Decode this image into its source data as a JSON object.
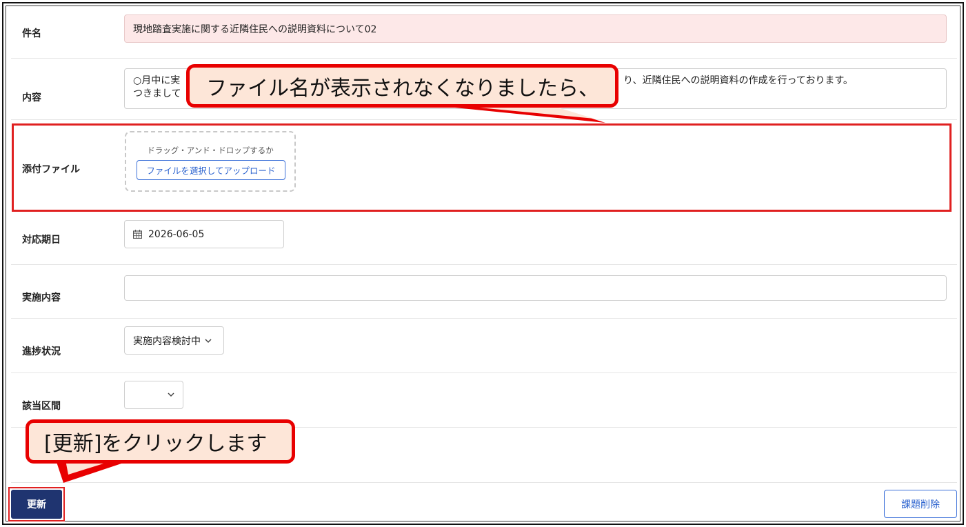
{
  "form": {
    "subject": {
      "label": "件名",
      "value": "現地踏査実施に関する近隣住民への説明資料について02"
    },
    "content": {
      "label": "内容",
      "line1_start": "○月中に実",
      "line1_end": "り、近隣住民への説明資料の作成を行っております。",
      "line2_start": "つきまして"
    },
    "attachment": {
      "label": "添付ファイル",
      "drop_text": "ドラッグ・アンド・ドロップするか",
      "select_button": "ファイルを選択してアップロード"
    },
    "due_date": {
      "label": "対応期日",
      "value": "2026-06-05"
    },
    "action": {
      "label": "実施内容",
      "value": ""
    },
    "status": {
      "label": "進捗状況",
      "value": "実施内容検討中"
    },
    "section": {
      "label": "該当区間",
      "value": ""
    }
  },
  "buttons": {
    "update": "更新",
    "delete": "課題削除"
  },
  "callouts": {
    "top": "ファイル名が表示されなくなりましたら、",
    "bottom": "[更新]をクリックします"
  },
  "colors": {
    "accent_red": "#e80000",
    "callout_bg": "#fde6d8",
    "primary_button": "#1f3470",
    "link_blue": "#2d64cf"
  }
}
